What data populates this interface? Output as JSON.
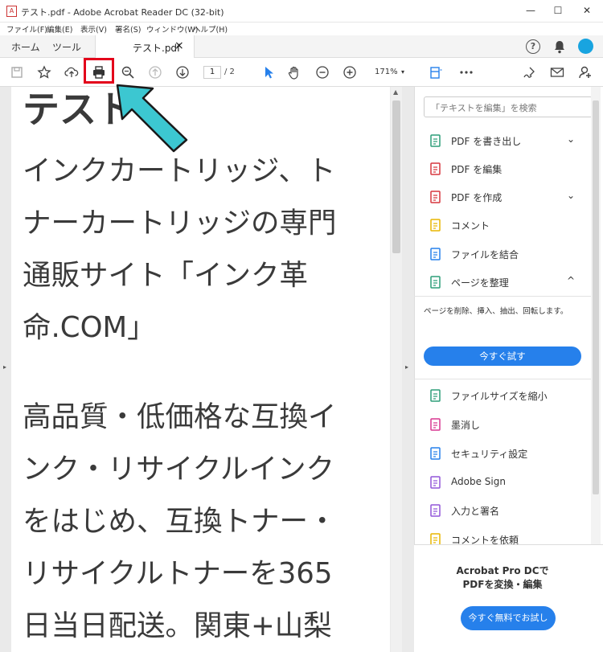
{
  "window": {
    "title": "テスト.pdf - Adobe Acrobat Reader DC (32-bit)",
    "pdf_icon": "pdf-icon",
    "minimize": "—",
    "maximize": "☐",
    "close": "✕"
  },
  "menu": [
    "ファイル(F)",
    "編集(E)",
    "表示(V)",
    "署名(S)",
    "ウィンドウ(W)",
    "ヘルプ(H)"
  ],
  "tabs": {
    "home": "ホーム",
    "tools": "ツール",
    "document": "テスト.pdf",
    "close": "×"
  },
  "toolbar": {
    "page_current": "1",
    "page_total": "/ 2",
    "zoom": "171%"
  },
  "document": {
    "heading": "テスト",
    "paragraphs": [
      "インクカートリッジ、ト\nナーカートリッジの専門\n通販サイト「インク革\n命.COM」",
      "高品質・低価格な互換イ\nンク・リサイクルインク\nをはじめ、互換トナー・\nリサイクルトナーを365\n日当日配送。関東+山梨"
    ]
  },
  "right_pane": {
    "search_placeholder": "「テキストを編集」を検索",
    "tools": [
      {
        "label": "PDF を書き出し",
        "icon": "export-pdf-icon",
        "chevron": "⌄",
        "color": "#2d9d78"
      },
      {
        "label": "PDF を編集",
        "icon": "edit-pdf-icon",
        "chevron": "",
        "color": "#d7373f"
      },
      {
        "label": "PDF を作成",
        "icon": "create-pdf-icon",
        "chevron": "⌄",
        "color": "#d7373f"
      },
      {
        "label": "コメント",
        "icon": "comment-icon",
        "chevron": "",
        "color": "#e8b600"
      },
      {
        "label": "ファイルを結合",
        "icon": "combine-files-icon",
        "chevron": "",
        "color": "#2680eb"
      },
      {
        "label": "ページを整理",
        "icon": "organize-pages-icon",
        "chevron": "^",
        "color": "#2d9d78"
      }
    ],
    "organize_desc": "ページを削除、挿入、抽出、回転します。",
    "try_now": "今すぐ試す",
    "more_tools": [
      {
        "label": "ファイルサイズを縮小",
        "icon": "compress-icon",
        "color": "#2d9d78"
      },
      {
        "label": "墨消し",
        "icon": "redact-icon",
        "color": "#d83790"
      },
      {
        "label": "セキュリティ設定",
        "icon": "protect-icon",
        "color": "#2680eb"
      },
      {
        "label": "Adobe Sign",
        "icon": "adobe-sign-icon",
        "color": "#9256d9"
      },
      {
        "label": "入力と署名",
        "icon": "fill-sign-icon",
        "color": "#9256d9"
      },
      {
        "label": "コメントを依頼",
        "icon": "request-comment-icon",
        "color": "#e8b600"
      }
    ],
    "promo_line1": "Acrobat Pro DCで",
    "promo_line2": "PDFを変換・編集",
    "promo_button": "今すぐ無料でお試し"
  },
  "colors": {
    "accent": "#2680eb",
    "highlight": "#e3001b",
    "arrow": "#3cc7d1"
  }
}
